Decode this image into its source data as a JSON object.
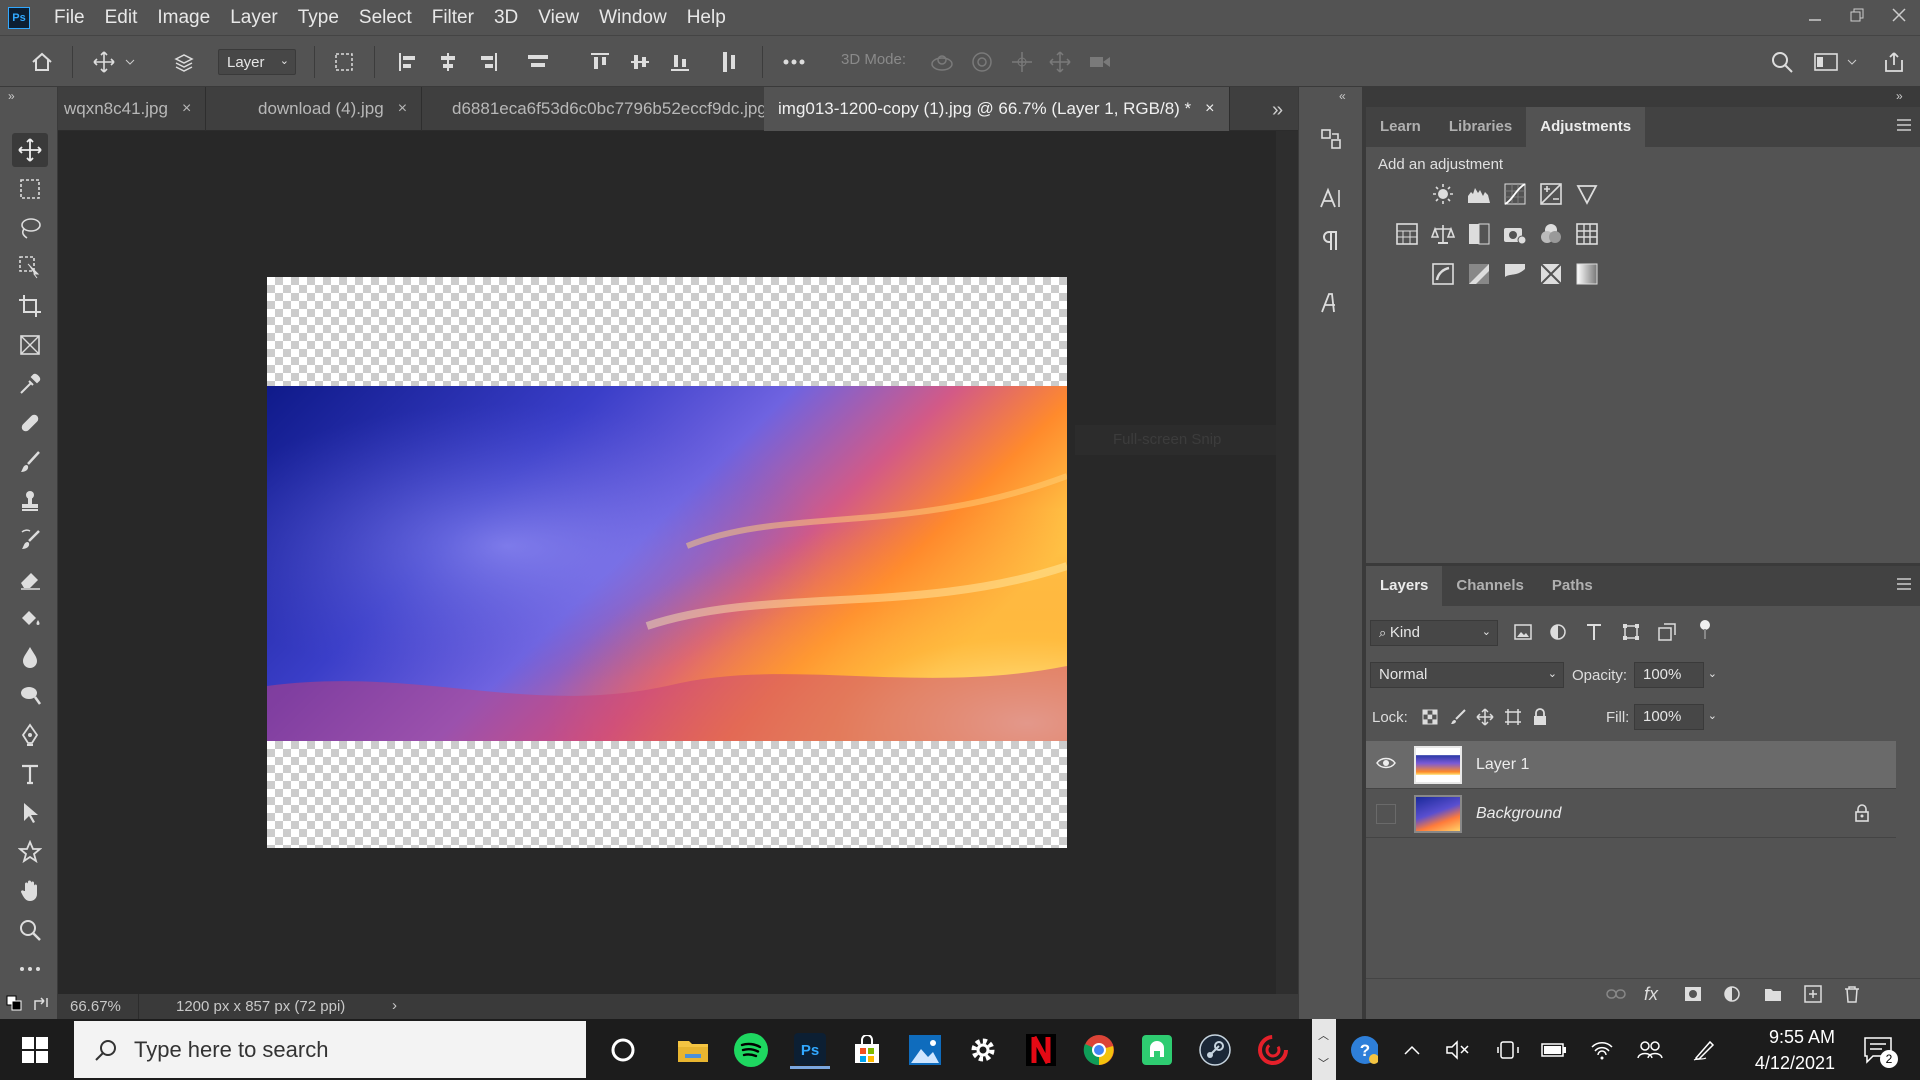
{
  "menubar": {
    "logo": "Ps",
    "items": [
      "File",
      "Edit",
      "Image",
      "Layer",
      "Type",
      "Select",
      "Filter",
      "3D",
      "View",
      "Window",
      "Help"
    ]
  },
  "options": {
    "auto_select_value": "Layer",
    "mode_3d_label": "3D Mode:"
  },
  "tabs": [
    {
      "label": "wqxn8c41.jpg"
    },
    {
      "label": "download (4).jpg"
    },
    {
      "label": "d6881eca6f53d6c0bc7796b52eccf9dc.jpg"
    },
    {
      "label": "img013-1200-copy (1).jpg @ 66.7% (Layer 1, RGB/8) *",
      "active": true
    }
  ],
  "status": {
    "zoom": "66.67%",
    "doc_info": "1200 px x 857 px (72 ppi)",
    "arrow": "›"
  },
  "canvas": {
    "ghost_text": "Full-screen Snip"
  },
  "adjustments_panel": {
    "tabs": [
      "Learn",
      "Libraries",
      "Adjustments"
    ],
    "active_tab": "Adjustments",
    "heading": "Add an adjustment",
    "icons": [
      [
        "brightness-contrast-icon",
        "levels-icon",
        "curves-icon",
        "exposure-icon",
        "vibrance-icon"
      ],
      [
        "hue-saturation-icon",
        "color-balance-icon",
        "black-white-icon",
        "photo-filter-icon",
        "channel-mixer-icon",
        "color-lookup-icon"
      ],
      [
        "invert-icon",
        "posterize-icon",
        "threshold-icon",
        "selective-color-icon",
        "gradient-map-icon"
      ]
    ]
  },
  "layers_panel": {
    "tabs": [
      "Layers",
      "Channels",
      "Paths"
    ],
    "active_tab": "Layers",
    "filter_kind": "Kind",
    "blend_mode": "Normal",
    "opacity_label": "Opacity:",
    "opacity_value": "100%",
    "lock_label": "Lock:",
    "fill_label": "Fill:",
    "fill_value": "100%",
    "layers": [
      {
        "name": "Layer 1",
        "visible": true,
        "selected": true
      },
      {
        "name": "Background",
        "visible": false,
        "locked": true,
        "italic": true
      }
    ]
  },
  "taskbar": {
    "search_placeholder": "Type here to search",
    "time": "9:55 AM",
    "date": "4/12/2021",
    "notification_count": "2"
  },
  "colors": {
    "chrome": "#535353",
    "canvas_bg": "#282828",
    "accent": "#31a8ff"
  }
}
